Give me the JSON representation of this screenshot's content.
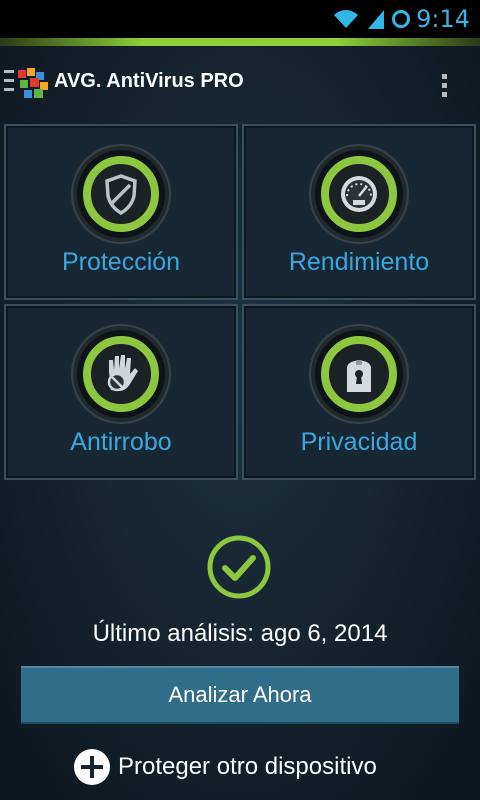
{
  "status_bar": {
    "time": "9:14"
  },
  "header": {
    "brand": "AVG.",
    "title": "AntiVirus PRO"
  },
  "tiles": [
    {
      "label": "Protección",
      "icon": "shield-icon"
    },
    {
      "label": "Rendimiento",
      "icon": "speedometer-icon"
    },
    {
      "label": "Antirrobo",
      "icon": "hand-stop-icon"
    },
    {
      "label": "Privacidad",
      "icon": "keyhole-lock-icon"
    }
  ],
  "status": {
    "last_scan": "Último análisis: ago 6, 2014",
    "icon": "check-icon"
  },
  "actions": {
    "scan_now": "Analizar Ahora",
    "protect_device": "Proteger otro dispositivo"
  },
  "colors": {
    "accent_green": "#8dc63f",
    "label_blue": "#3aa8de",
    "status_blue": "#33b5e5",
    "button_bg": "#2f6d88"
  }
}
